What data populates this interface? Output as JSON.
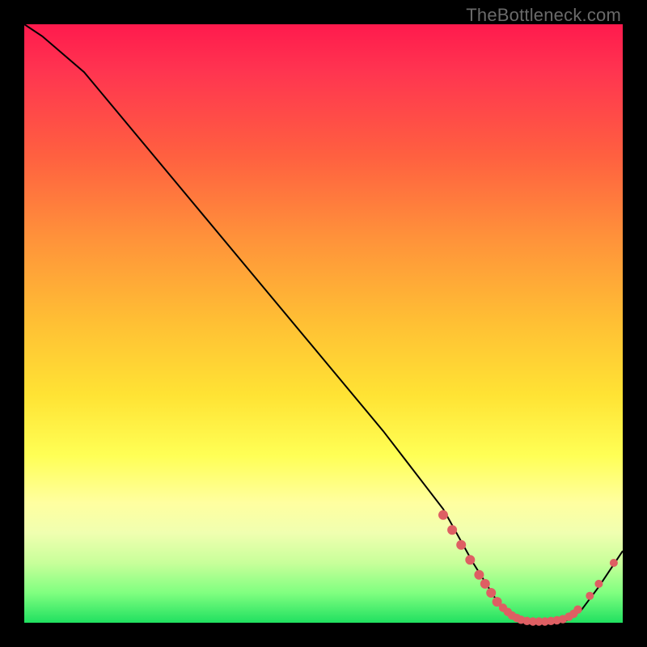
{
  "watermark": "TheBottleneck.com",
  "colors": {
    "background": "#000000",
    "gradient_top": "#ff1a4d",
    "gradient_mid": "#ffe334",
    "gradient_bottom": "#20e060",
    "curve": "#000000",
    "markers": "#de5f63"
  },
  "chart_data": {
    "type": "line",
    "title": "",
    "xlabel": "",
    "ylabel": "",
    "xlim": [
      0,
      100
    ],
    "ylim": [
      0,
      100
    ],
    "x": [
      0,
      3,
      10,
      20,
      30,
      40,
      50,
      60,
      70,
      75,
      80,
      85,
      90,
      93,
      96,
      100
    ],
    "values": [
      100,
      98,
      92,
      80,
      68,
      56,
      44,
      32,
      19,
      10,
      2,
      0,
      0,
      2,
      6,
      12
    ],
    "marker_points": [
      {
        "x": 70.0,
        "y": 18.0
      },
      {
        "x": 71.5,
        "y": 15.5
      },
      {
        "x": 73.0,
        "y": 13.0
      },
      {
        "x": 74.5,
        "y": 10.5
      },
      {
        "x": 76.0,
        "y": 8.0
      },
      {
        "x": 77.0,
        "y": 6.5
      },
      {
        "x": 78.0,
        "y": 5.0
      },
      {
        "x": 79.0,
        "y": 3.5
      },
      {
        "x": 80.0,
        "y": 2.5
      },
      {
        "x": 80.8,
        "y": 1.8
      },
      {
        "x": 81.5,
        "y": 1.2
      },
      {
        "x": 82.3,
        "y": 0.8
      },
      {
        "x": 83.0,
        "y": 0.5
      },
      {
        "x": 84.0,
        "y": 0.3
      },
      {
        "x": 85.0,
        "y": 0.2
      },
      {
        "x": 86.0,
        "y": 0.2
      },
      {
        "x": 87.0,
        "y": 0.2
      },
      {
        "x": 88.0,
        "y": 0.3
      },
      {
        "x": 89.0,
        "y": 0.4
      },
      {
        "x": 90.0,
        "y": 0.6
      },
      {
        "x": 91.0,
        "y": 1.0
      },
      {
        "x": 91.8,
        "y": 1.5
      },
      {
        "x": 92.5,
        "y": 2.2
      },
      {
        "x": 94.5,
        "y": 4.5
      },
      {
        "x": 96.0,
        "y": 6.5
      },
      {
        "x": 98.5,
        "y": 10.0
      }
    ]
  }
}
